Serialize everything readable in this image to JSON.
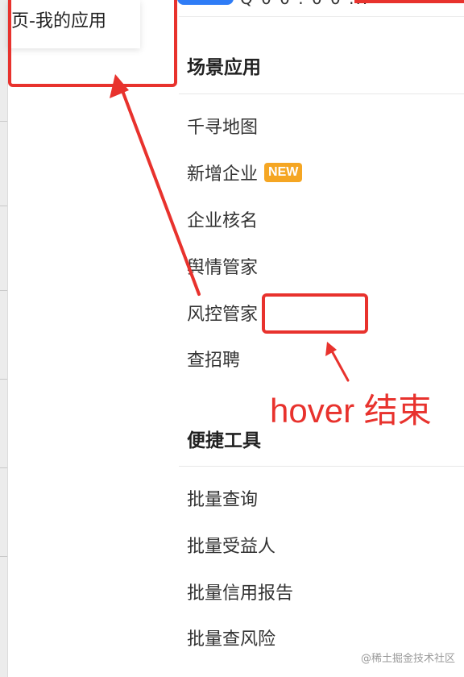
{
  "menu_card": {
    "label": "页-我的应用"
  },
  "top_bar": {
    "cut_text": "Q 0 0 . 0 0 ..."
  },
  "sections": [
    {
      "title": "场景应用",
      "items": [
        {
          "label": "千寻地图",
          "badge": ""
        },
        {
          "label": "新增企业",
          "badge": "NEW"
        },
        {
          "label": "企业核名",
          "badge": ""
        },
        {
          "label": "舆情管家",
          "badge": ""
        },
        {
          "label": "风控管家",
          "badge": ""
        },
        {
          "label": "查招聘",
          "badge": ""
        }
      ]
    },
    {
      "title": "便捷工具",
      "items": [
        {
          "label": "批量查询",
          "badge": ""
        },
        {
          "label": "批量受益人",
          "badge": ""
        },
        {
          "label": "批量信用报告",
          "badge": ""
        },
        {
          "label": "批量查风险",
          "badge": ""
        }
      ]
    }
  ],
  "annotation": {
    "text": "hover 结束",
    "color": "#e8322d"
  },
  "colors": {
    "accent_blue": "#2f7cf6",
    "badge_orange": "#f5a623",
    "annotation_red": "#e8322d"
  },
  "watermark": "@稀土掘金技术社区"
}
